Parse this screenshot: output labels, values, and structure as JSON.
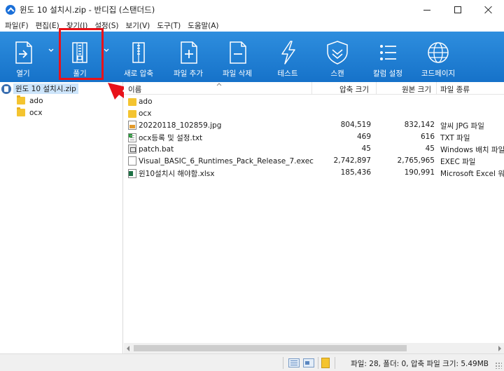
{
  "window": {
    "title": "윈도 10 설치시.zip - 반디집 (스탠더드)"
  },
  "menu": [
    "파일(F)",
    "편집(E)",
    "찾기(I)",
    "설정(S)",
    "보기(V)",
    "도구(T)",
    "도움말(A)"
  ],
  "toolbar": {
    "open": "열기",
    "extract": "풀기",
    "new_archive": "새로 압축",
    "add_file": "파일 추가",
    "delete_file": "파일 삭제",
    "test": "테스트",
    "scan": "스캔",
    "column_settings": "칼럼 설정",
    "codepage": "코드페이지"
  },
  "tree": {
    "root": "윈도 10 설치시.zip",
    "folders": [
      "ado",
      "ocx"
    ]
  },
  "columns": {
    "name": "이름",
    "packed": "압축 크기",
    "original": "원본 크기",
    "type": "파일 종류"
  },
  "files": [
    {
      "name": "ado",
      "icon": "folder-icon",
      "packed": "",
      "original": "",
      "type": ""
    },
    {
      "name": "ocx",
      "icon": "folder-icon",
      "packed": "",
      "original": "",
      "type": ""
    },
    {
      "name": "20220118_102859.jpg",
      "icon": "jpg-file-icon",
      "packed": "804,519",
      "original": "832,142",
      "type": "알씨 JPG 파일"
    },
    {
      "name": "ocx등록 및 설정.txt",
      "icon": "txt-file-icon",
      "packed": "469",
      "original": "616",
      "type": "TXT 파일"
    },
    {
      "name": "patch.bat",
      "icon": "bat-file-icon",
      "packed": "45",
      "original": "45",
      "type": "Windows 배치 파일"
    },
    {
      "name": "Visual_BASIC_6_Runtimes_Pack_Release_7.exec",
      "icon": "exec-file-icon",
      "packed": "2,742,897",
      "original": "2,765,965",
      "type": "EXEC 파일"
    },
    {
      "name": "윈10설치시 해야함.xlsx",
      "icon": "xlsx-file-icon",
      "packed": "185,436",
      "original": "190,991",
      "type": "Microsoft Excel 워크시트"
    }
  ],
  "status": {
    "text": "파일: 28, 폴더: 0, 압축 파일 크기: 5.49MB"
  },
  "colors": {
    "toolbar": "#1f7fd6",
    "highlight": "#e8121a",
    "selection": "#cde5fb"
  }
}
